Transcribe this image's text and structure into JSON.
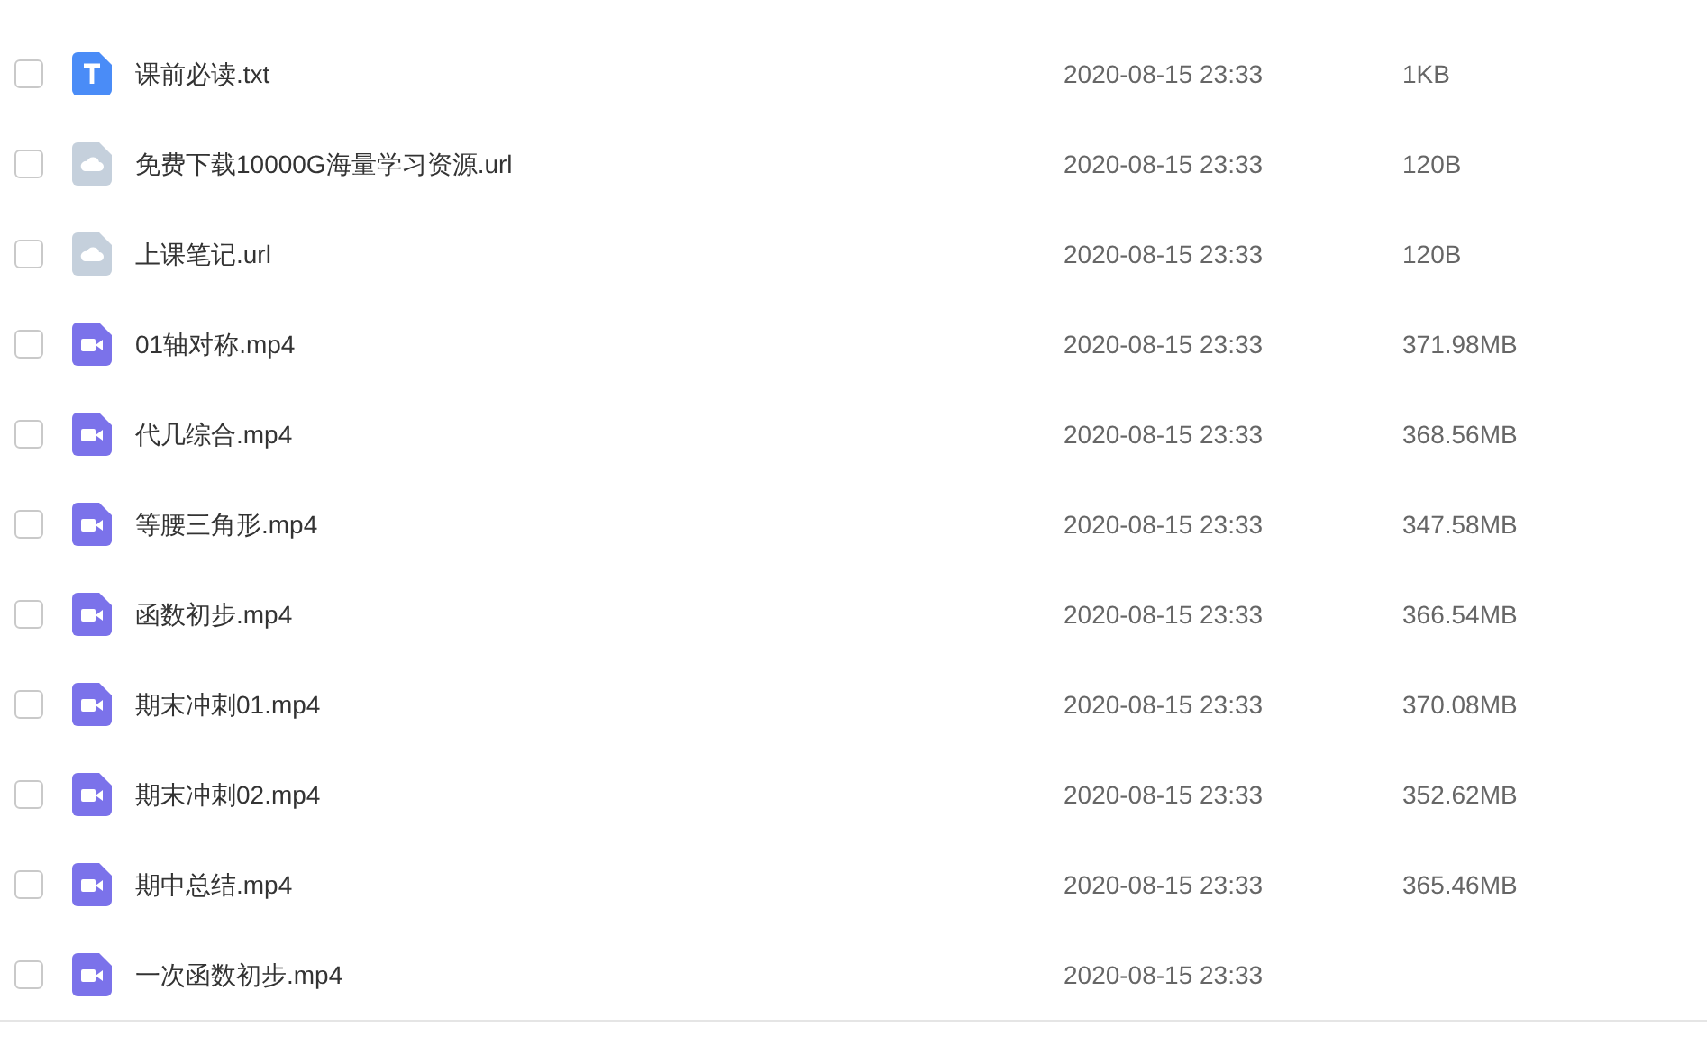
{
  "files": [
    {
      "kind": "text",
      "name": "课前必读.txt",
      "modified": "2020-08-15 23:33",
      "size": "1KB",
      "checked": false
    },
    {
      "kind": "link",
      "name": "免费下载10000G海量学习资源.url",
      "modified": "2020-08-15 23:33",
      "size": "120B",
      "checked": false
    },
    {
      "kind": "link",
      "name": "上课笔记.url",
      "modified": "2020-08-15 23:33",
      "size": "120B",
      "checked": false
    },
    {
      "kind": "video",
      "name": "01轴对称.mp4",
      "modified": "2020-08-15 23:33",
      "size": "371.98MB",
      "checked": false
    },
    {
      "kind": "video",
      "name": "代几综合.mp4",
      "modified": "2020-08-15 23:33",
      "size": "368.56MB",
      "checked": false
    },
    {
      "kind": "video",
      "name": "等腰三角形.mp4",
      "modified": "2020-08-15 23:33",
      "size": "347.58MB",
      "checked": false
    },
    {
      "kind": "video",
      "name": "函数初步.mp4",
      "modified": "2020-08-15 23:33",
      "size": "366.54MB",
      "checked": false
    },
    {
      "kind": "video",
      "name": "期末冲刺01.mp4",
      "modified": "2020-08-15 23:33",
      "size": "370.08MB",
      "checked": false
    },
    {
      "kind": "video",
      "name": "期末冲刺02.mp4",
      "modified": "2020-08-15 23:33",
      "size": "352.62MB",
      "checked": false
    },
    {
      "kind": "video",
      "name": "期中总结.mp4",
      "modified": "2020-08-15 23:33",
      "size": "365.46MB",
      "checked": false
    },
    {
      "kind": "video",
      "name": "一次函数初步.mp4",
      "modified": "2020-08-15 23:33",
      "checked": false
    }
  ]
}
